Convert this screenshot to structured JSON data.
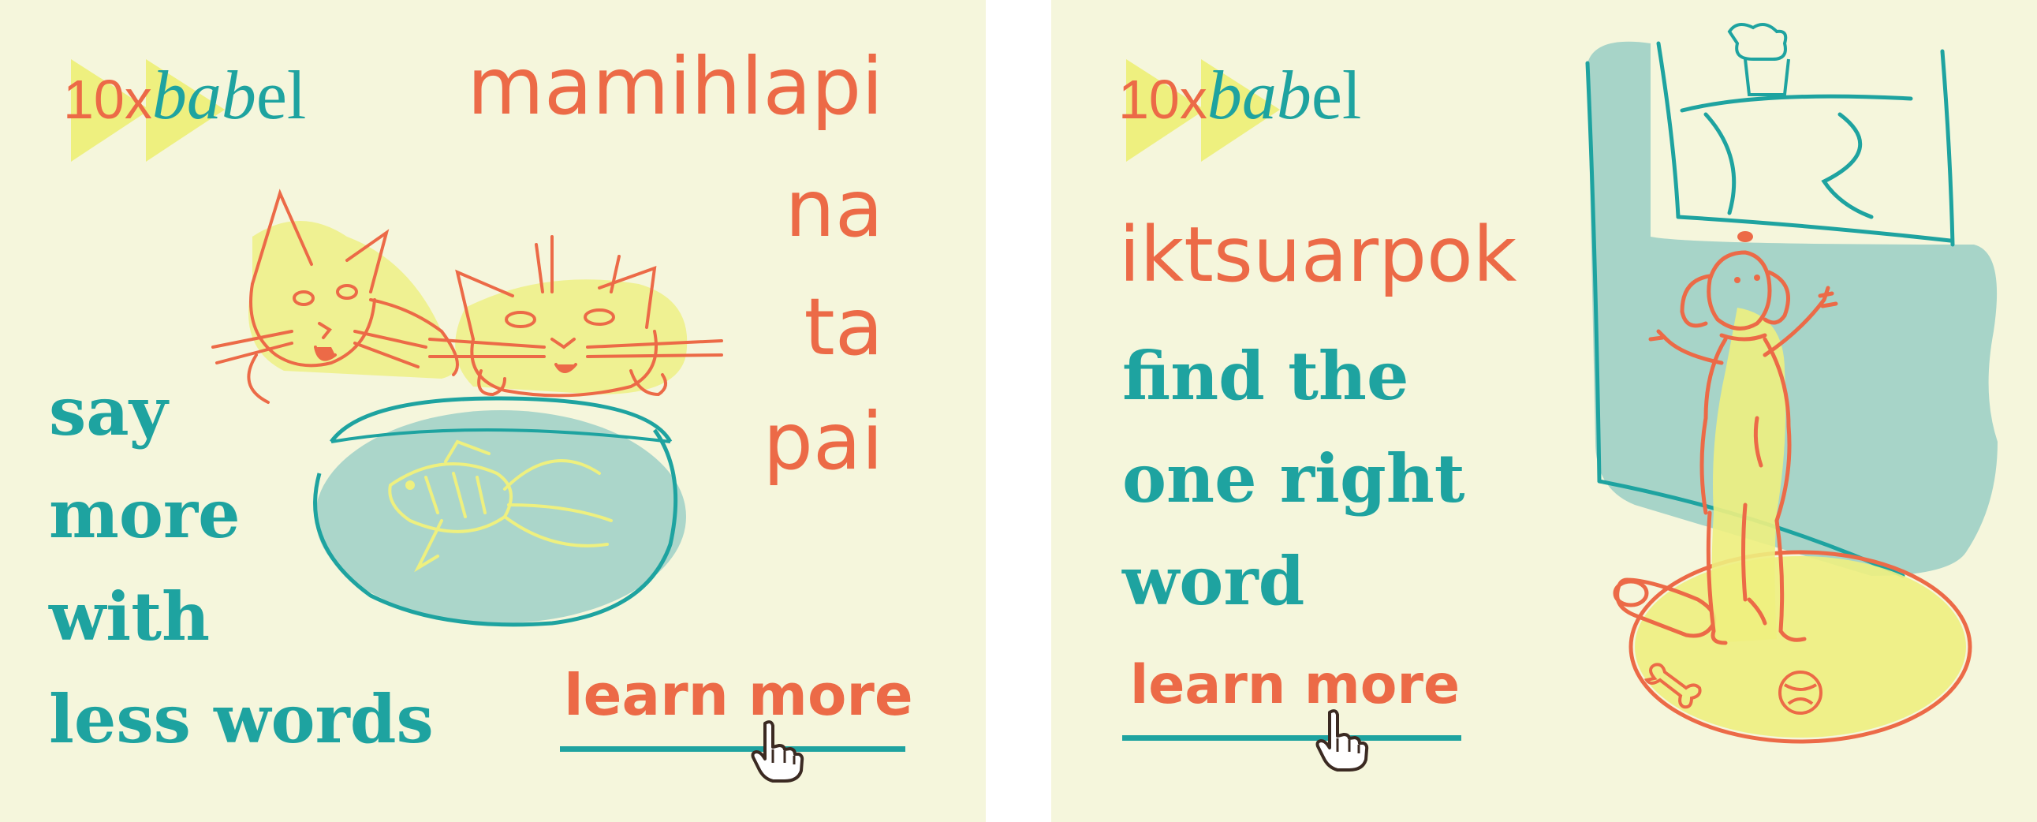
{
  "brand": {
    "logo_prefix": "10x",
    "logo_italic": "bab",
    "logo_suffix": "el",
    "colors": {
      "teal": "#1ea3a0",
      "coral": "#ec6a47",
      "yellow": "#eef07f",
      "cream": "#f5f6dc",
      "aqua": "#a7d4c8"
    }
  },
  "ads": [
    {
      "word_lines": [
        "mamihlapi",
        "na",
        "ta",
        "pai"
      ],
      "tagline_lines": [
        "say",
        "more",
        "with",
        "less words"
      ],
      "cta": "learn more",
      "illustration": "two-cats-watching-fishbowl"
    },
    {
      "word_lines": [
        "iktsuarpok"
      ],
      "tagline_lines": [
        "find the",
        "one right",
        "word"
      ],
      "cta": "learn more",
      "illustration": "dog-looking-out-window"
    }
  ],
  "icons": [
    "fast-forward-icon",
    "hand-pointer-icon"
  ]
}
